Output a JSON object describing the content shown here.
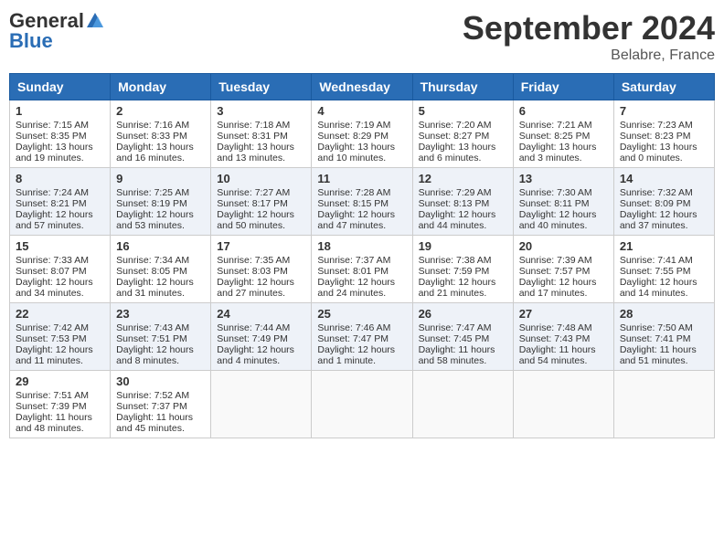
{
  "header": {
    "logo_general": "General",
    "logo_blue": "Blue",
    "month_title": "September 2024",
    "location": "Belabre, France"
  },
  "weekdays": [
    "Sunday",
    "Monday",
    "Tuesday",
    "Wednesday",
    "Thursday",
    "Friday",
    "Saturday"
  ],
  "weeks": [
    [
      {
        "day": "1",
        "sunrise": "7:15 AM",
        "sunset": "8:35 PM",
        "daylight": "13 hours and 19 minutes."
      },
      {
        "day": "2",
        "sunrise": "7:16 AM",
        "sunset": "8:33 PM",
        "daylight": "13 hours and 16 minutes."
      },
      {
        "day": "3",
        "sunrise": "7:18 AM",
        "sunset": "8:31 PM",
        "daylight": "13 hours and 13 minutes."
      },
      {
        "day": "4",
        "sunrise": "7:19 AM",
        "sunset": "8:29 PM",
        "daylight": "13 hours and 10 minutes."
      },
      {
        "day": "5",
        "sunrise": "7:20 AM",
        "sunset": "8:27 PM",
        "daylight": "13 hours and 6 minutes."
      },
      {
        "day": "6",
        "sunrise": "7:21 AM",
        "sunset": "8:25 PM",
        "daylight": "13 hours and 3 minutes."
      },
      {
        "day": "7",
        "sunrise": "7:23 AM",
        "sunset": "8:23 PM",
        "daylight": "13 hours and 0 minutes."
      }
    ],
    [
      {
        "day": "8",
        "sunrise": "7:24 AM",
        "sunset": "8:21 PM",
        "daylight": "12 hours and 57 minutes."
      },
      {
        "day": "9",
        "sunrise": "7:25 AM",
        "sunset": "8:19 PM",
        "daylight": "12 hours and 53 minutes."
      },
      {
        "day": "10",
        "sunrise": "7:27 AM",
        "sunset": "8:17 PM",
        "daylight": "12 hours and 50 minutes."
      },
      {
        "day": "11",
        "sunrise": "7:28 AM",
        "sunset": "8:15 PM",
        "daylight": "12 hours and 47 minutes."
      },
      {
        "day": "12",
        "sunrise": "7:29 AM",
        "sunset": "8:13 PM",
        "daylight": "12 hours and 44 minutes."
      },
      {
        "day": "13",
        "sunrise": "7:30 AM",
        "sunset": "8:11 PM",
        "daylight": "12 hours and 40 minutes."
      },
      {
        "day": "14",
        "sunrise": "7:32 AM",
        "sunset": "8:09 PM",
        "daylight": "12 hours and 37 minutes."
      }
    ],
    [
      {
        "day": "15",
        "sunrise": "7:33 AM",
        "sunset": "8:07 PM",
        "daylight": "12 hours and 34 minutes."
      },
      {
        "day": "16",
        "sunrise": "7:34 AM",
        "sunset": "8:05 PM",
        "daylight": "12 hours and 31 minutes."
      },
      {
        "day": "17",
        "sunrise": "7:35 AM",
        "sunset": "8:03 PM",
        "daylight": "12 hours and 27 minutes."
      },
      {
        "day": "18",
        "sunrise": "7:37 AM",
        "sunset": "8:01 PM",
        "daylight": "12 hours and 24 minutes."
      },
      {
        "day": "19",
        "sunrise": "7:38 AM",
        "sunset": "7:59 PM",
        "daylight": "12 hours and 21 minutes."
      },
      {
        "day": "20",
        "sunrise": "7:39 AM",
        "sunset": "7:57 PM",
        "daylight": "12 hours and 17 minutes."
      },
      {
        "day": "21",
        "sunrise": "7:41 AM",
        "sunset": "7:55 PM",
        "daylight": "12 hours and 14 minutes."
      }
    ],
    [
      {
        "day": "22",
        "sunrise": "7:42 AM",
        "sunset": "7:53 PM",
        "daylight": "12 hours and 11 minutes."
      },
      {
        "day": "23",
        "sunrise": "7:43 AM",
        "sunset": "7:51 PM",
        "daylight": "12 hours and 8 minutes."
      },
      {
        "day": "24",
        "sunrise": "7:44 AM",
        "sunset": "7:49 PM",
        "daylight": "12 hours and 4 minutes."
      },
      {
        "day": "25",
        "sunrise": "7:46 AM",
        "sunset": "7:47 PM",
        "daylight": "12 hours and 1 minute."
      },
      {
        "day": "26",
        "sunrise": "7:47 AM",
        "sunset": "7:45 PM",
        "daylight": "11 hours and 58 minutes."
      },
      {
        "day": "27",
        "sunrise": "7:48 AM",
        "sunset": "7:43 PM",
        "daylight": "11 hours and 54 minutes."
      },
      {
        "day": "28",
        "sunrise": "7:50 AM",
        "sunset": "7:41 PM",
        "daylight": "11 hours and 51 minutes."
      }
    ],
    [
      {
        "day": "29",
        "sunrise": "7:51 AM",
        "sunset": "7:39 PM",
        "daylight": "11 hours and 48 minutes."
      },
      {
        "day": "30",
        "sunrise": "7:52 AM",
        "sunset": "7:37 PM",
        "daylight": "11 hours and 45 minutes."
      },
      null,
      null,
      null,
      null,
      null
    ]
  ]
}
